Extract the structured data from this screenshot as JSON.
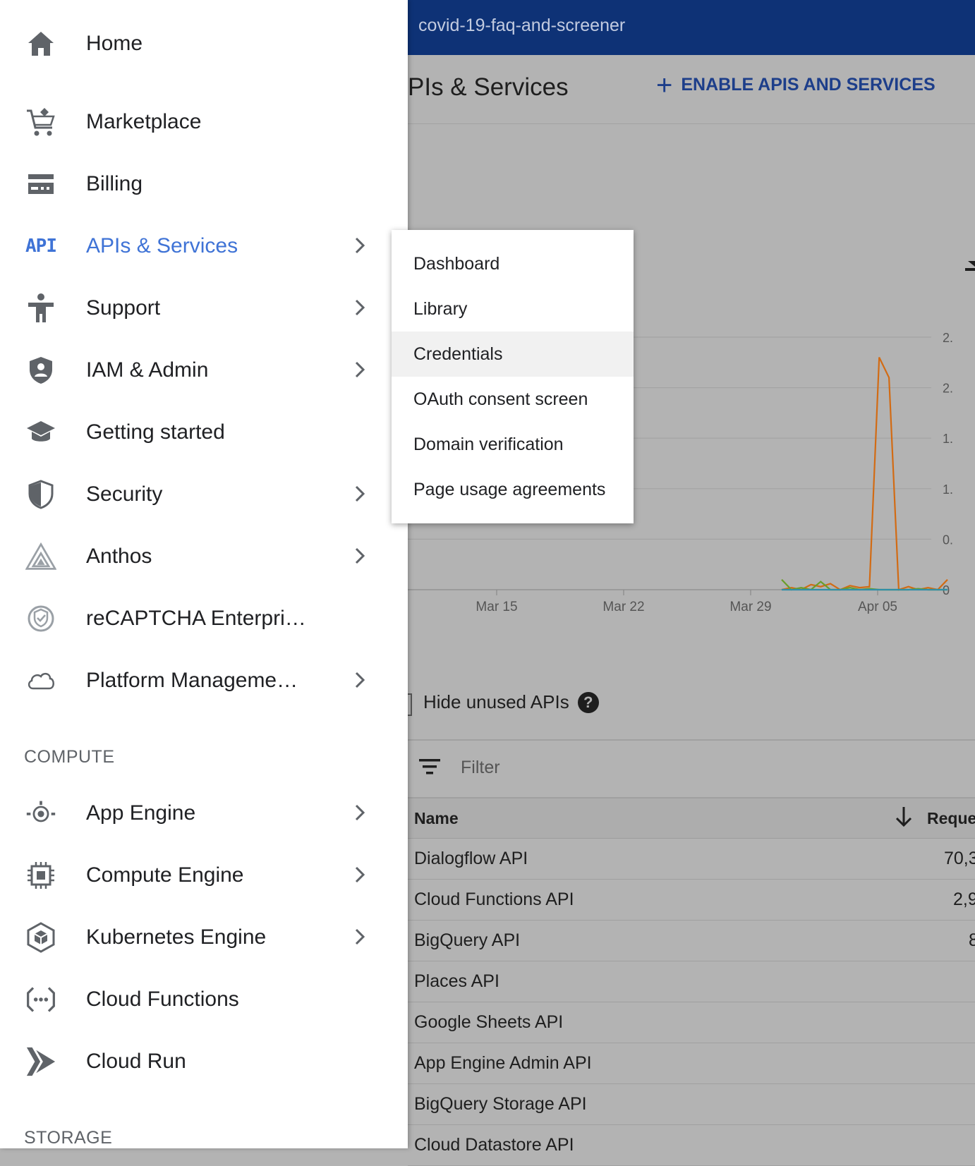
{
  "topbar": {
    "project": "covid-19-faq-and-screener"
  },
  "header": {
    "title": "PIs & Services",
    "enable_label": "ENABLE APIS AND SERVICES"
  },
  "chart_data": {
    "type": "line",
    "x_ticks": [
      "Mar 15",
      "Mar 22",
      "Mar 29",
      "Apr 05"
    ],
    "y_ticks": [
      "2.",
      "2.",
      "1.",
      "1.",
      "0.",
      "0"
    ],
    "series": [
      {
        "color": "#d26b14",
        "values": [
          0,
          0.02,
          0,
          0.05,
          0.03,
          0.06,
          0,
          0.04,
          0.02,
          0.03,
          2.3,
          2.1,
          0,
          0.03,
          0,
          0.02,
          0,
          0.1
        ]
      },
      {
        "color": "#6a9e2b",
        "values": [
          0.1,
          0,
          0.02,
          0,
          0.08,
          0,
          0,
          0.02,
          0,
          0.01,
          0,
          0,
          0,
          0,
          0.01,
          0,
          0,
          0
        ]
      },
      {
        "color": "#2f8fa8",
        "values": [
          0,
          0,
          0,
          0,
          0,
          0,
          0,
          0,
          0,
          0,
          0,
          0,
          0,
          0,
          0,
          0,
          0,
          0
        ]
      }
    ]
  },
  "controls": {
    "hide_unused": "Hide unused APIs",
    "help": "?",
    "filter_placeholder": "Filter"
  },
  "table": {
    "headers": {
      "name": "Name",
      "requests": "Reque"
    },
    "rows": [
      {
        "name": "Dialogflow API",
        "value": "70,3"
      },
      {
        "name": "Cloud Functions API",
        "value": "2,9"
      },
      {
        "name": "BigQuery API",
        "value": "8"
      },
      {
        "name": "Places API",
        "value": ""
      },
      {
        "name": "Google Sheets API",
        "value": ""
      },
      {
        "name": "App Engine Admin API",
        "value": ""
      },
      {
        "name": "BigQuery Storage API",
        "value": ""
      },
      {
        "name": "Cloud Datastore API",
        "value": ""
      }
    ]
  },
  "drawer": {
    "items": [
      {
        "label": "Home",
        "icon": "home-icon"
      },
      {
        "label": "Marketplace",
        "icon": "marketplace-icon"
      },
      {
        "label": "Billing",
        "icon": "billing-icon"
      },
      {
        "label": "APIs & Services",
        "icon": "api-icon"
      },
      {
        "label": "Support",
        "icon": "support-icon"
      },
      {
        "label": "IAM & Admin",
        "icon": "iam-shield-icon"
      },
      {
        "label": "Getting started",
        "icon": "graduation-cap-icon"
      },
      {
        "label": "Security",
        "icon": "security-shield-icon"
      },
      {
        "label": "Anthos",
        "icon": "anthos-icon"
      },
      {
        "label": "reCAPTCHA Enterpri…",
        "icon": "recaptcha-icon"
      },
      {
        "label": "Platform Manageme…",
        "icon": "cloud-icon"
      }
    ],
    "api_icon_text": "API",
    "compute_section": "COMPUTE",
    "compute_items": [
      {
        "label": "App Engine",
        "icon": "app-engine-icon"
      },
      {
        "label": "Compute Engine",
        "icon": "chip-icon"
      },
      {
        "label": "Kubernetes Engine",
        "icon": "kubernetes-icon"
      },
      {
        "label": "Cloud Functions",
        "icon": "cloud-functions-icon"
      },
      {
        "label": "Cloud Run",
        "icon": "cloud-run-icon"
      }
    ],
    "storage_section": "STORAGE"
  },
  "submenu": {
    "items": [
      "Dashboard",
      "Library",
      "Credentials",
      "OAuth consent screen",
      "Domain verification",
      "Page usage agreements"
    ]
  },
  "colors": {
    "topbar": "#0e3276",
    "active": "#3f73d6",
    "accent": "#1d3e8a"
  }
}
